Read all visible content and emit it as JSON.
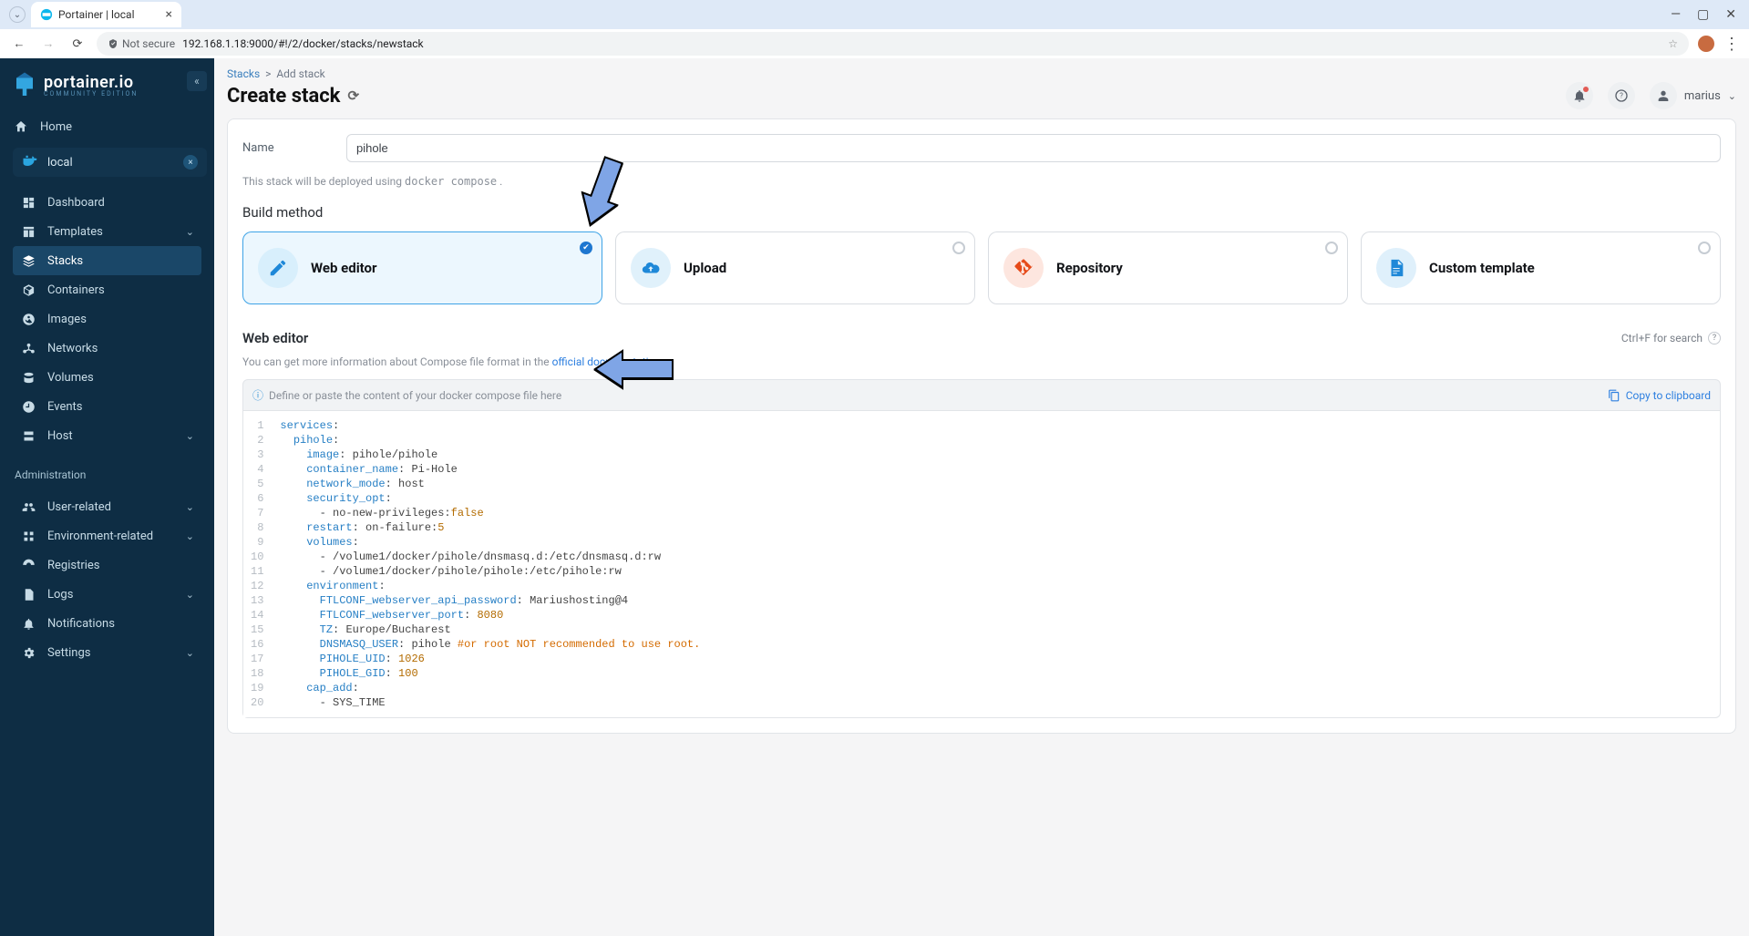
{
  "browser": {
    "tab_title": "Portainer | local",
    "security_label": "Not secure",
    "url": "192.168.1.18:9000/#!/2/docker/stacks/newstack"
  },
  "brand": {
    "name": "portainer.io",
    "edition": "COMMUNITY EDITION"
  },
  "sidebar": {
    "home": "Home",
    "env": "local",
    "items": [
      "Dashboard",
      "Templates",
      "Stacks",
      "Containers",
      "Images",
      "Networks",
      "Volumes",
      "Events",
      "Host"
    ],
    "admin_title": "Administration",
    "admin_items": [
      "User-related",
      "Environment-related",
      "Registries",
      "Logs",
      "Notifications",
      "Settings"
    ]
  },
  "header": {
    "crumb_root": "Stacks",
    "crumb_leaf": "Add stack",
    "page_title": "Create stack",
    "user_name": "marius"
  },
  "form": {
    "name_label": "Name",
    "name_value": "pihole",
    "deploy_hint_pre": "This stack will be deployed using ",
    "deploy_hint_code": "docker compose",
    "build_method_label": "Build method",
    "methods": {
      "web_editor": "Web editor",
      "upload": "Upload",
      "repository": "Repository",
      "custom_template": "Custom template"
    }
  },
  "editor": {
    "title": "Web editor",
    "search_hint": "Ctrl+F for search",
    "sub_pre": "You can get more information about Compose file format in the ",
    "sub_link": "official documentation",
    "placeholder_hint": "Define or paste the content of your docker compose file here",
    "copy_label": "Copy to clipboard",
    "lines": [
      {
        "n": 1,
        "tokens": [
          [
            "k",
            "services"
          ],
          [
            "p",
            ":"
          ]
        ]
      },
      {
        "n": 2,
        "tokens": [
          [
            "i",
            "  "
          ],
          [
            "k",
            "pihole"
          ],
          [
            "p",
            ":"
          ]
        ]
      },
      {
        "n": 3,
        "tokens": [
          [
            "i",
            "    "
          ],
          [
            "k",
            "image"
          ],
          [
            "p",
            ": "
          ],
          [
            "s",
            "pihole/pihole"
          ]
        ]
      },
      {
        "n": 4,
        "tokens": [
          [
            "i",
            "    "
          ],
          [
            "k",
            "container_name"
          ],
          [
            "p",
            ": "
          ],
          [
            "s",
            "Pi-Hole"
          ]
        ]
      },
      {
        "n": 5,
        "tokens": [
          [
            "i",
            "    "
          ],
          [
            "k",
            "network_mode"
          ],
          [
            "p",
            ": "
          ],
          [
            "s",
            "host"
          ]
        ]
      },
      {
        "n": 6,
        "tokens": [
          [
            "i",
            "    "
          ],
          [
            "k",
            "security_opt"
          ],
          [
            "p",
            ":"
          ]
        ]
      },
      {
        "n": 7,
        "tokens": [
          [
            "i",
            "      "
          ],
          [
            "p",
            "- "
          ],
          [
            "s",
            "no-new-privileges:"
          ],
          [
            "b",
            "false"
          ]
        ]
      },
      {
        "n": 8,
        "tokens": [
          [
            "i",
            "    "
          ],
          [
            "k",
            "restart"
          ],
          [
            "p",
            ": "
          ],
          [
            "s",
            "on-failure:"
          ],
          [
            "n",
            "5"
          ]
        ]
      },
      {
        "n": 9,
        "tokens": [
          [
            "i",
            "    "
          ],
          [
            "k",
            "volumes"
          ],
          [
            "p",
            ":"
          ]
        ]
      },
      {
        "n": 10,
        "tokens": [
          [
            "i",
            "      "
          ],
          [
            "p",
            "- "
          ],
          [
            "s",
            "/volume1/docker/pihole/dnsmasq.d:/etc/dnsmasq.d:rw"
          ]
        ]
      },
      {
        "n": 11,
        "tokens": [
          [
            "i",
            "      "
          ],
          [
            "p",
            "- "
          ],
          [
            "s",
            "/volume1/docker/pihole/pihole:/etc/pihole:rw"
          ]
        ]
      },
      {
        "n": 12,
        "tokens": [
          [
            "i",
            "    "
          ],
          [
            "k",
            "environment"
          ],
          [
            "p",
            ":"
          ]
        ]
      },
      {
        "n": 13,
        "tokens": [
          [
            "i",
            "      "
          ],
          [
            "k",
            "FTLCONF_webserver_api_password"
          ],
          [
            "p",
            ": "
          ],
          [
            "s",
            "Mariushosting@4"
          ]
        ]
      },
      {
        "n": 14,
        "tokens": [
          [
            "i",
            "      "
          ],
          [
            "k",
            "FTLCONF_webserver_port"
          ],
          [
            "p",
            ": "
          ],
          [
            "n",
            "8080"
          ]
        ]
      },
      {
        "n": 15,
        "tokens": [
          [
            "i",
            "      "
          ],
          [
            "k",
            "TZ"
          ],
          [
            "p",
            ": "
          ],
          [
            "s",
            "Europe/Bucharest"
          ]
        ]
      },
      {
        "n": 16,
        "tokens": [
          [
            "i",
            "      "
          ],
          [
            "k",
            "DNSMASQ_USER"
          ],
          [
            "p",
            ": "
          ],
          [
            "s",
            "pihole "
          ],
          [
            "c",
            "#or root NOT recommended to use root."
          ]
        ]
      },
      {
        "n": 17,
        "tokens": [
          [
            "i",
            "      "
          ],
          [
            "k",
            "PIHOLE_UID"
          ],
          [
            "p",
            ": "
          ],
          [
            "n",
            "1026"
          ]
        ]
      },
      {
        "n": 18,
        "tokens": [
          [
            "i",
            "      "
          ],
          [
            "k",
            "PIHOLE_GID"
          ],
          [
            "p",
            ": "
          ],
          [
            "n",
            "100"
          ]
        ]
      },
      {
        "n": 19,
        "tokens": [
          [
            "i",
            "    "
          ],
          [
            "k",
            "cap_add"
          ],
          [
            "p",
            ":"
          ]
        ]
      },
      {
        "n": 20,
        "tokens": [
          [
            "i",
            "      "
          ],
          [
            "p",
            "- "
          ],
          [
            "s",
            "SYS_TIME"
          ]
        ]
      }
    ]
  }
}
